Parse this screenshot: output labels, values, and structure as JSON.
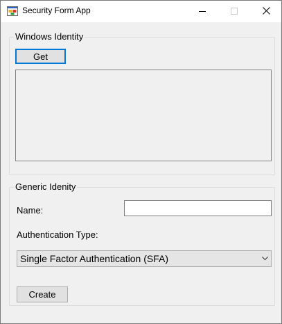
{
  "window": {
    "title": "Security Form App"
  },
  "windows_identity": {
    "legend": "Windows Identity",
    "get_label": "Get",
    "output_text": ""
  },
  "generic_identity": {
    "legend": "Generic Idenity",
    "name_label": "Name:",
    "name_value": "",
    "auth_type_label": "Authentication Type:",
    "auth_type_selected": "Single Factor Authentication (SFA)",
    "create_label": "Create"
  },
  "icons": {
    "app": "app-icon",
    "minimize": "minimize-icon",
    "maximize": "maximize-icon",
    "close": "close-icon",
    "dropdown": "chevron-down-icon"
  },
  "colors": {
    "client_bg": "#f0f0f0",
    "focus_border": "#0078d7",
    "button_bg": "#e1e1e1"
  }
}
